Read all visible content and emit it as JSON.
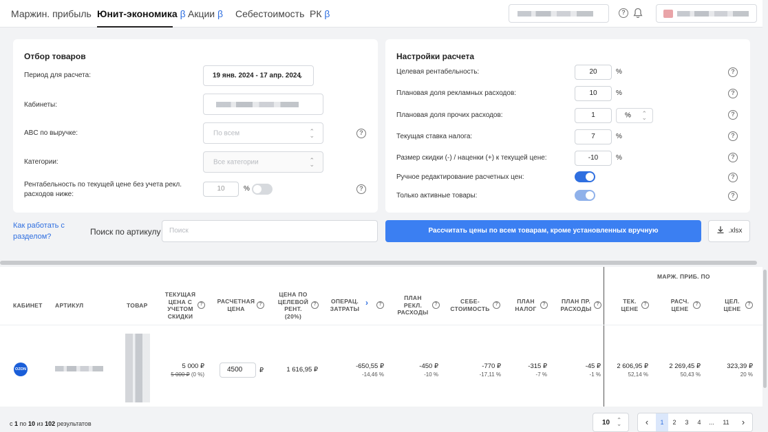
{
  "tabs": [
    {
      "label": "Маржин. прибыль",
      "beta": ""
    },
    {
      "label": "Юнит-экономика",
      "beta": "β"
    },
    {
      "label": "Акции",
      "beta": "β"
    },
    {
      "label": "Себестоимость",
      "beta": ""
    },
    {
      "label": "РК",
      "beta": "β"
    }
  ],
  "icons": {
    "help": "?",
    "bell": "bell-icon",
    "chevron": "⌄",
    "updown": "⌃⌄",
    "download": "download-icon",
    "prev": "‹",
    "next": "›",
    "sort_arrow": "›"
  },
  "filter": {
    "title": "Отбор товаров",
    "period_label": "Период для расчета:",
    "period_value": "19 янв. 2024 - 17 апр. 2024",
    "cabinets_label": "Кабинеты:",
    "abc_label": "ABC по выручке:",
    "abc_placeholder": "По всем",
    "categories_label": "Категории:",
    "categories_placeholder": "Все категории",
    "rent_label": "Рентабельность по текущей цене без учета рекл. расходов ниже:",
    "rent_value": "10",
    "rent_unit": "%"
  },
  "settings": {
    "title": "Настройки расчета",
    "rows": [
      {
        "label": "Целевая рентабельность:",
        "value": "20",
        "unit": "%"
      },
      {
        "label": "Плановая доля рекламных расходов:",
        "value": "10",
        "unit": "%"
      },
      {
        "label": "Плановая доля прочих расходов:",
        "value": "1",
        "unit": "%"
      },
      {
        "label": "Текущая ставка налога:",
        "value": "7",
        "unit": "%"
      },
      {
        "label": "Размер скидки (-) / наценки (+) к текущей цене:",
        "value": "-10",
        "unit": "%"
      }
    ],
    "manual_label": "Ручное редактирование расчетных цен:",
    "active_label": "Только активные товары:"
  },
  "actions": {
    "howto_link": "Как работать с разделом?",
    "search_label": "Поиск по артикулу",
    "search_placeholder": "Поиск",
    "calc_button": "Рассчитать цены по всем товарам, кроме установленных вручную",
    "xlsx_button": ".xlsx"
  },
  "table": {
    "group_header": "МАРЖ. ПРИБ. ПО",
    "columns": {
      "cabinet": "КАБИНЕТ",
      "article": "АРТИКУЛ",
      "product": "ТОВАР",
      "cur_price": "ТЕКУЩАЯ ЦЕНА С УЧЕТОМ СКИДКИ",
      "calc_price": "РАСЧЕТНАЯ ЦЕНА",
      "target_price": "ЦЕНА ПО ЦЕЛЕВОЙ РЕНТ. (20%)",
      "opex": "ОПЕРАЦ. ЗАТРАТЫ",
      "ad_plan": "ПЛАН РЕКЛ. РАСХОДЫ",
      "cost": "СЕБЕ-СТОИМОСТЬ",
      "tax_plan": "ПЛАН НАЛОГ",
      "other_plan": "ПЛАН ПР. РАСХОДЫ",
      "m_cur": "ТЕК. ЦЕНЕ",
      "m_calc": "РАСЧ. ЦЕНЕ",
      "m_target": "ЦЕЛ. ЦЕНЕ"
    },
    "row": {
      "cabinet_badge": "OZON",
      "cur_price": "5 000 ₽",
      "cur_price_old": "5 000 ₽",
      "cur_price_disc": "(0 %)",
      "calc_price": "4500",
      "calc_currency": "₽",
      "target_price": "1 616,95 ₽",
      "opex": "-650,55 ₽",
      "opex_pct": "-14,46 %",
      "ad_plan": "-450 ₽",
      "ad_plan_pct": "-10 %",
      "cost": "-770 ₽",
      "cost_pct": "-17,11 %",
      "tax_plan": "-315 ₽",
      "tax_plan_pct": "-7 %",
      "other_plan": "-45 ₽",
      "other_plan_pct": "-1 %",
      "m_cur": "2 606,95 ₽",
      "m_cur_pct": "52,14 %",
      "m_calc": "2 269,45 ₽",
      "m_calc_pct": "50,43 %",
      "m_target": "323,39 ₽",
      "m_target_pct": "20 %"
    }
  },
  "footer": {
    "count_prefix": "с",
    "count_from": "1",
    "count_mid1": "по",
    "count_to": "10",
    "count_mid2": "из",
    "count_total": "102",
    "count_suffix": "результатов",
    "per_page": "10",
    "pages": [
      "1",
      "2",
      "3",
      "4",
      "...",
      "11"
    ]
  }
}
